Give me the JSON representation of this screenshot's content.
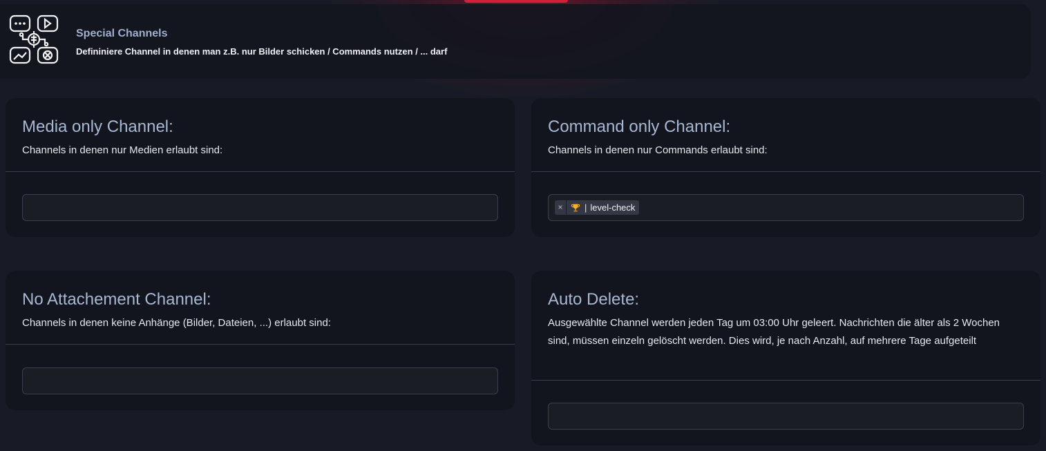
{
  "header": {
    "title": "Special Channels",
    "subtitle": "Defininiere Channel in denen man z.B. nur Bilder schicken / Commands nutzen / ... darf",
    "logo_icon": "channels-logo-icon"
  },
  "cards": {
    "media": {
      "title": "Media only Channel:",
      "description": "Channels in denen nur Medien erlaubt sind:"
    },
    "command": {
      "title": "Command only Channel:",
      "description": "Channels in denen nur Commands erlaubt sind:",
      "selected_channels": [
        {
          "icon": "trophy-icon",
          "separator": "|",
          "label": "level-check",
          "remove": "×"
        }
      ]
    },
    "no_attachment": {
      "title": "No Attachement Channel:",
      "description": "Channels in denen keine Anhänge (Bilder, Dateien, ...) erlaubt sind:"
    },
    "auto_delete": {
      "title": "Auto Delete:",
      "description": "Ausgewählte Channel werden jeden Tag um 03:00 Uhr geleert. Nachrichten die älter als 2 Wochen sind, müssen einzeln gelöscht werden. Dies wird, je nach Anzahl, auf mehrere Tage aufgeteilt"
    }
  },
  "colors": {
    "background": "#181b25",
    "card": "#12151d",
    "title": "#a8b8d2",
    "accent": "#d1213a"
  }
}
